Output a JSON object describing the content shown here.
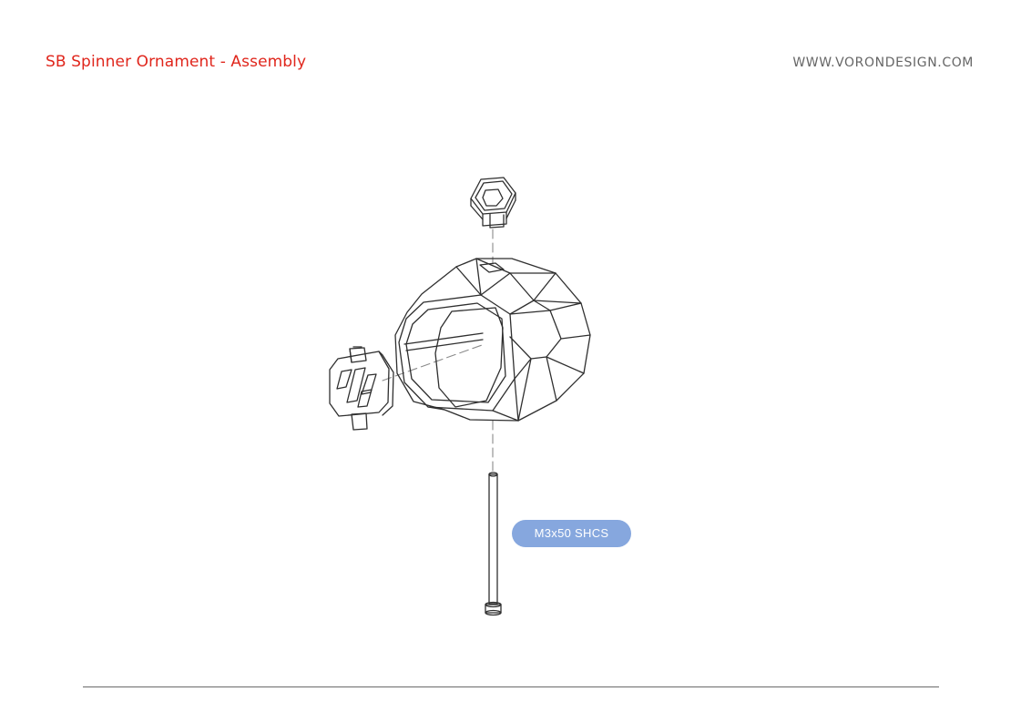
{
  "header": {
    "title": "SB Spinner Ornament - Assembly",
    "website": "WWW.VORONDESIGN.COM"
  },
  "callouts": {
    "screw": "M3x50 SHCS"
  },
  "colors": {
    "title": "#e0261c",
    "website": "#666666",
    "callout_fill": "#86a7de",
    "callout_text": "#ffffff",
    "line_art": "#2f2f2f"
  }
}
